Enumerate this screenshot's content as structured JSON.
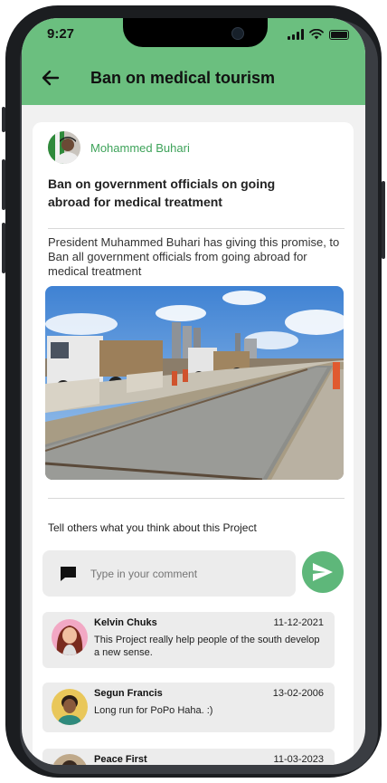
{
  "status_bar": {
    "time": "9:27"
  },
  "app_bar": {
    "title": "Ban on medical tourism",
    "back_icon": "arrow-left-icon"
  },
  "post": {
    "author": "Mohammed Buhari",
    "headline": "Ban on government officials on going abroad for medical treatment",
    "description": "President Muhammed Buhari has giving this promise, to Ban all government officials from going abroad for medical treatment",
    "photo": "road-construction-photo"
  },
  "comment_section": {
    "prompt": "Tell others what you think about this Project",
    "input_placeholder": "Type in your comment",
    "input_icon": "comment-icon",
    "send_icon": "send-icon"
  },
  "comments": [
    {
      "name": "Kelvin Chuks",
      "date": "11-12-2021",
      "text": "This Project really help people of the south develop a new sense."
    },
    {
      "name": "Segun Francis",
      "date": "13-02-2006",
      "text": "Long run for PoPo Haha. :)"
    },
    {
      "name": "Peace First",
      "date": "11-03-2023",
      "text": ""
    }
  ],
  "colors": {
    "accent": "#6bbf7f",
    "author": "#3ea35a",
    "send": "#5eb77a"
  }
}
